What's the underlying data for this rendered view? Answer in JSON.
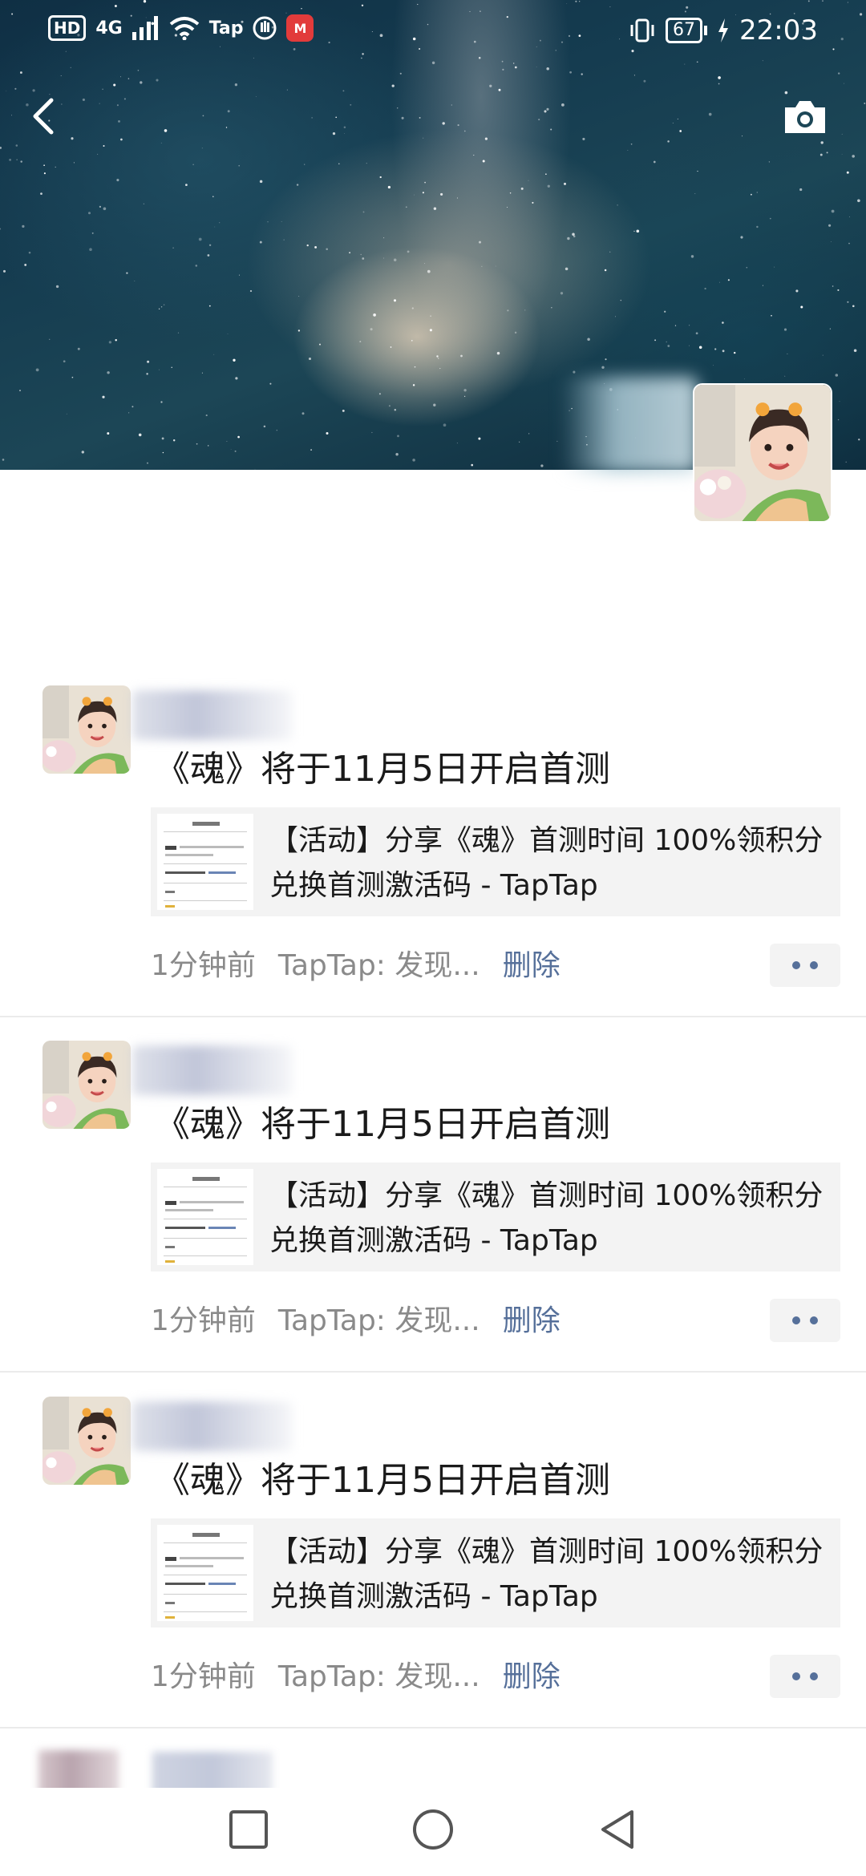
{
  "status_bar": {
    "left_badges": [
      "HD",
      "4G",
      "Tap"
    ],
    "carrier_icon_text": "M",
    "battery_level": "67",
    "time": "22:03"
  },
  "icons": {
    "back": "chevron-left-icon",
    "camera": "camera-icon",
    "wifi": "wifi-icon",
    "signal": "signal-icon",
    "vibrate": "vibrate-icon",
    "charging": "charging-bolt-icon",
    "more": "more-dots-icon",
    "nav_recent": "square-icon",
    "nav_home": "circle-icon",
    "nav_back": "triangle-back-icon"
  },
  "colors": {
    "link_blue": "#56709a",
    "meta_gray": "#8a8a8a",
    "card_bg": "#f3f3f3"
  },
  "posts": [
    {
      "text": "《魂》将于11月5日开启首测",
      "link_title": "【活动】分享《魂》首测时间 100%领积分兑换首测激活码 - TapTap",
      "time": "1分钟前",
      "source": "TapTap: 发现...",
      "delete_label": "删除"
    },
    {
      "text": "《魂》将于11月5日开启首测",
      "link_title": "【活动】分享《魂》首测时间 100%领积分兑换首测激活码 - TapTap",
      "time": "1分钟前",
      "source": "TapTap: 发现...",
      "delete_label": "删除"
    },
    {
      "text": "《魂》将于11月5日开启首测",
      "link_title": "【活动】分享《魂》首测时间 100%领积分兑换首测激活码 - TapTap",
      "time": "1分钟前",
      "source": "TapTap: 发现...",
      "delete_label": "删除"
    }
  ]
}
